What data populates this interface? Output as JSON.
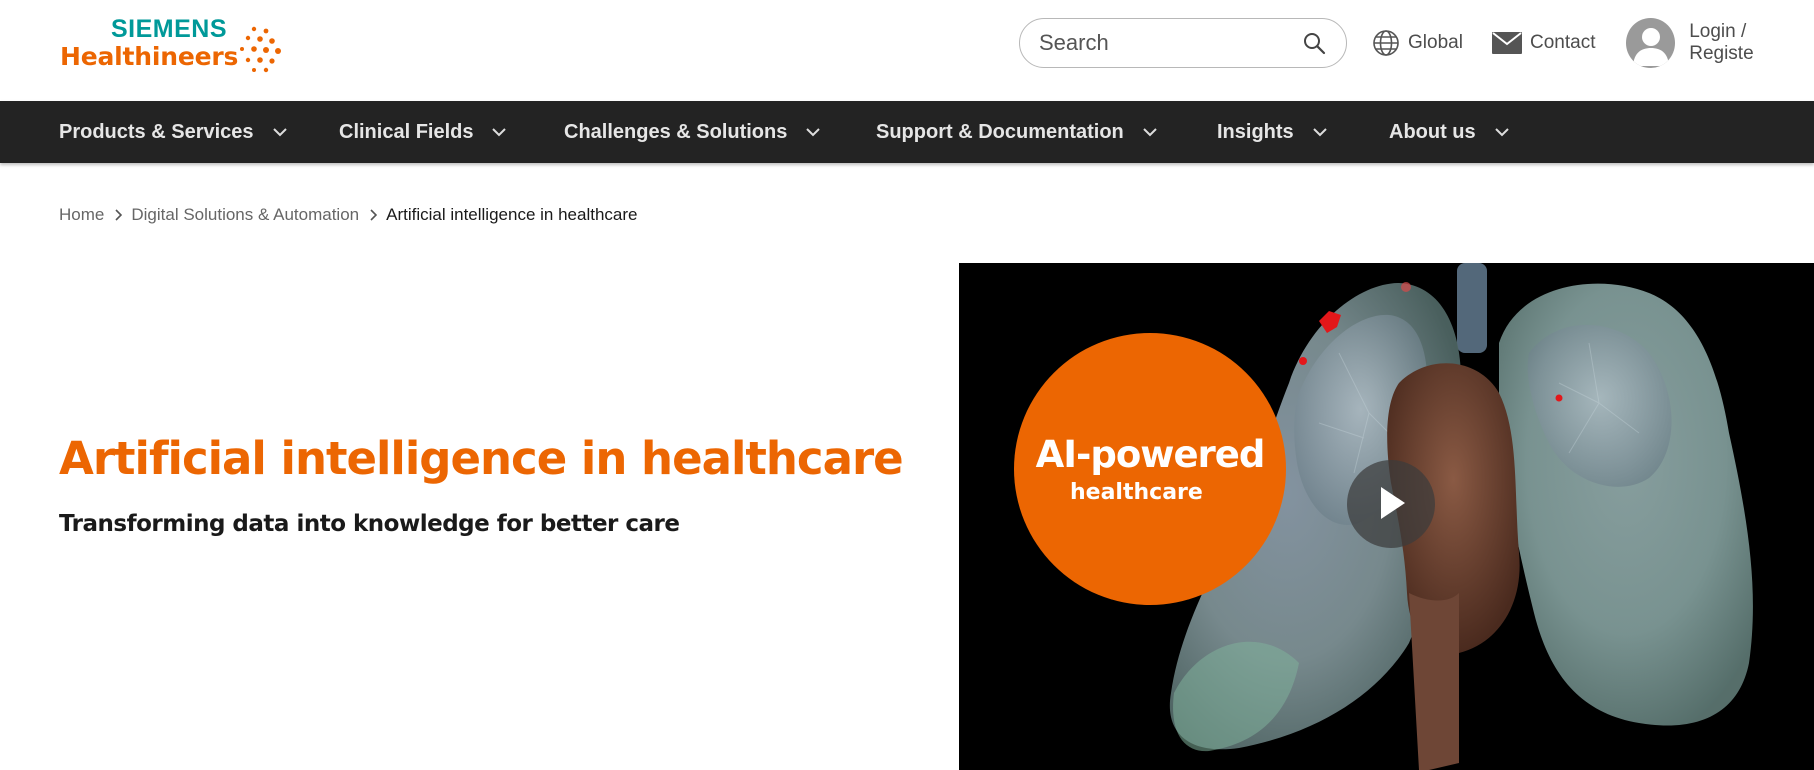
{
  "brand": {
    "line1": "SIEMENS",
    "line2": "Healthineers",
    "primary_color": "#ec6602",
    "secondary_color": "#009999"
  },
  "header": {
    "search_placeholder": "Search",
    "search_icon": "search-icon",
    "global_label": "Global",
    "global_icon": "globe-icon",
    "contact_label": "Contact",
    "contact_icon": "envelope-icon",
    "login_label": "Login / Registe",
    "login_icon": "avatar-icon"
  },
  "nav": {
    "items": [
      {
        "label": "Products & Services"
      },
      {
        "label": "Clinical Fields"
      },
      {
        "label": "Challenges & Solutions"
      },
      {
        "label": "Support & Documentation"
      },
      {
        "label": "Insights"
      },
      {
        "label": "About us"
      }
    ],
    "background": "#232323"
  },
  "breadcrumb": {
    "items": [
      "Home",
      "Digital Solutions & Automation",
      "Artificial intelligence in healthcare"
    ]
  },
  "hero": {
    "title": "Artificial intelligence in healthcare",
    "subtitle": "Transforming data into knowledge for better care"
  },
  "video": {
    "badge_line1": "AI-powered",
    "badge_line2": "healthcare",
    "play_icon": "play-icon"
  }
}
